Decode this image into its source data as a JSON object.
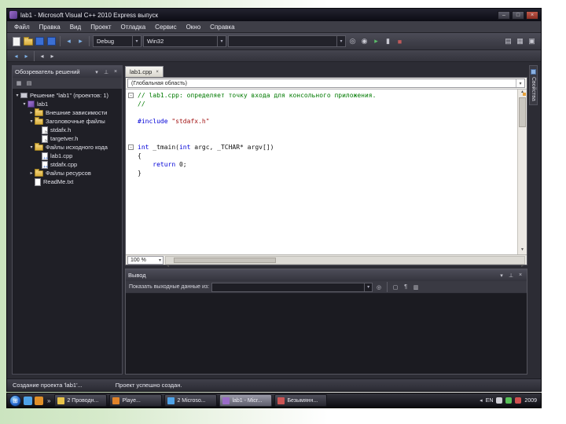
{
  "window": {
    "title": "lab1 - Microsoft Visual C++ 2010 Express выпуск",
    "controls": {
      "minimize": "–",
      "maximize": "□",
      "close": "×"
    }
  },
  "menu": {
    "items": [
      "Файл",
      "Правка",
      "Вид",
      "Проект",
      "Отладка",
      "Сервис",
      "Окно",
      "Справка"
    ]
  },
  "toolbars": {
    "main": {
      "left_icons": [
        "new-file-icon",
        "open-folder-icon",
        "save-icon",
        "save-all-icon",
        "separator",
        "undo-icon",
        "redo-icon",
        "separator"
      ],
      "config_combo": "Debug",
      "platform_combo": "Win32",
      "search_combo": "",
      "right_icons": [
        "find-icon",
        "find-in-files-icon",
        "start-debug-icon",
        "break-all-icon",
        "stop-icon"
      ],
      "far_icons": [
        "solution-explorer-icon",
        "properties-window-icon",
        "toolbox-icon"
      ]
    },
    "secondary": {
      "icons": [
        "navigate-back-icon",
        "navigate-forward-icon",
        "separator",
        "undo-small-icon",
        "redo-small-icon"
      ]
    }
  },
  "solution_explorer": {
    "title": "Обозреватель решений",
    "header_icons": [
      "window-menu-icon",
      "auto-hide-pin-icon",
      "close-icon"
    ],
    "toolbar_icons": [
      "properties-icon",
      "show-all-files-icon"
    ],
    "tree": [
      {
        "level": 0,
        "exp": "open",
        "icon": "solution",
        "label": "Решение \"lab1\" (проектов: 1)"
      },
      {
        "level": 1,
        "exp": "open",
        "icon": "project",
        "label": "lab1"
      },
      {
        "level": 2,
        "exp": "closed",
        "icon": "folder",
        "label": "Внешние зависимости"
      },
      {
        "level": 2,
        "exp": "open",
        "icon": "folder",
        "label": "Заголовочные файлы"
      },
      {
        "level": 3,
        "exp": "none",
        "icon": "header",
        "label": "stdafx.h"
      },
      {
        "level": 3,
        "exp": "none",
        "icon": "header",
        "label": "targetver.h"
      },
      {
        "level": 2,
        "exp": "open",
        "icon": "folder",
        "label": "Файлы исходного кода"
      },
      {
        "level": 3,
        "exp": "none",
        "icon": "cpp",
        "label": "lab1.cpp"
      },
      {
        "level": 3,
        "exp": "none",
        "icon": "cpp",
        "label": "stdafx.cpp"
      },
      {
        "level": 2,
        "exp": "closed",
        "icon": "folder",
        "label": "Файлы ресурсов"
      },
      {
        "level": 2,
        "exp": "none",
        "icon": "file",
        "label": "ReadMe.txt"
      }
    ]
  },
  "editor": {
    "tab_label": "lab1.cpp",
    "tab_close": "×",
    "scope_combo": "(Глобальная область)",
    "zoom": "100 %",
    "code": [
      {
        "fold": "minus",
        "tokens": [
          {
            "c": "com",
            "t": "// lab1.cpp: определяет точку входа для консольного приложения."
          }
        ]
      },
      {
        "fold": "",
        "tokens": [
          {
            "c": "com",
            "t": "//"
          }
        ]
      },
      {
        "fold": "",
        "tokens": []
      },
      {
        "fold": "",
        "tokens": [
          {
            "c": "kw",
            "t": "#include"
          },
          {
            "c": "pl",
            "t": " "
          },
          {
            "c": "str",
            "t": "\"stdafx.h\""
          }
        ]
      },
      {
        "fold": "",
        "tokens": []
      },
      {
        "fold": "",
        "tokens": []
      },
      {
        "fold": "minus",
        "tokens": [
          {
            "c": "kw",
            "t": "int"
          },
          {
            "c": "pl",
            "t": " _tmain("
          },
          {
            "c": "kw",
            "t": "int"
          },
          {
            "c": "pl",
            "t": " argc, _TCHAR* argv[])"
          }
        ]
      },
      {
        "fold": "",
        "tokens": [
          {
            "c": "pl",
            "t": "{"
          }
        ]
      },
      {
        "fold": "",
        "tokens": [
          {
            "c": "pl",
            "t": "\t"
          },
          {
            "c": "kw",
            "t": "return"
          },
          {
            "c": "pl",
            "t": " 0;"
          }
        ]
      },
      {
        "fold": "",
        "tokens": [
          {
            "c": "pl",
            "t": "}"
          }
        ]
      }
    ]
  },
  "output": {
    "title": "Вывод",
    "header_icons": [
      "window-menu-icon",
      "auto-hide-pin-icon",
      "close-icon"
    ],
    "show_label": "Показать выходные данные из:",
    "combo_value": "",
    "toolbar_icons": [
      "find-message-icon",
      "separator",
      "clear-all-icon",
      "wrap-icon",
      "toggle-icon"
    ]
  },
  "statusbar": {
    "message": "Создание проекта 'lab1'...",
    "message2": "Проект успешно создан."
  },
  "right_tab": {
    "label": "Свойства"
  },
  "taskbar": {
    "quick_icons": [
      {
        "name": "quick-launch-icon-1",
        "color": "#4fa3e8"
      },
      {
        "name": "quick-launch-icon-2",
        "color": "#e0902a"
      }
    ],
    "overflow_glyph": "»",
    "buttons": [
      {
        "label": "2 Проводн...",
        "icon": "explorer",
        "active": false
      },
      {
        "label": "Playe...",
        "icon": "player",
        "active": false
      },
      {
        "label": "2 Microso...",
        "icon": "ie",
        "active": false
      },
      {
        "label": "lab1 - Micr...",
        "icon": "visual-studio",
        "active": true
      },
      {
        "label": "Безымянн...",
        "icon": "paint",
        "active": false
      }
    ],
    "tray": {
      "lang": "EN",
      "clock": "2009"
    }
  }
}
